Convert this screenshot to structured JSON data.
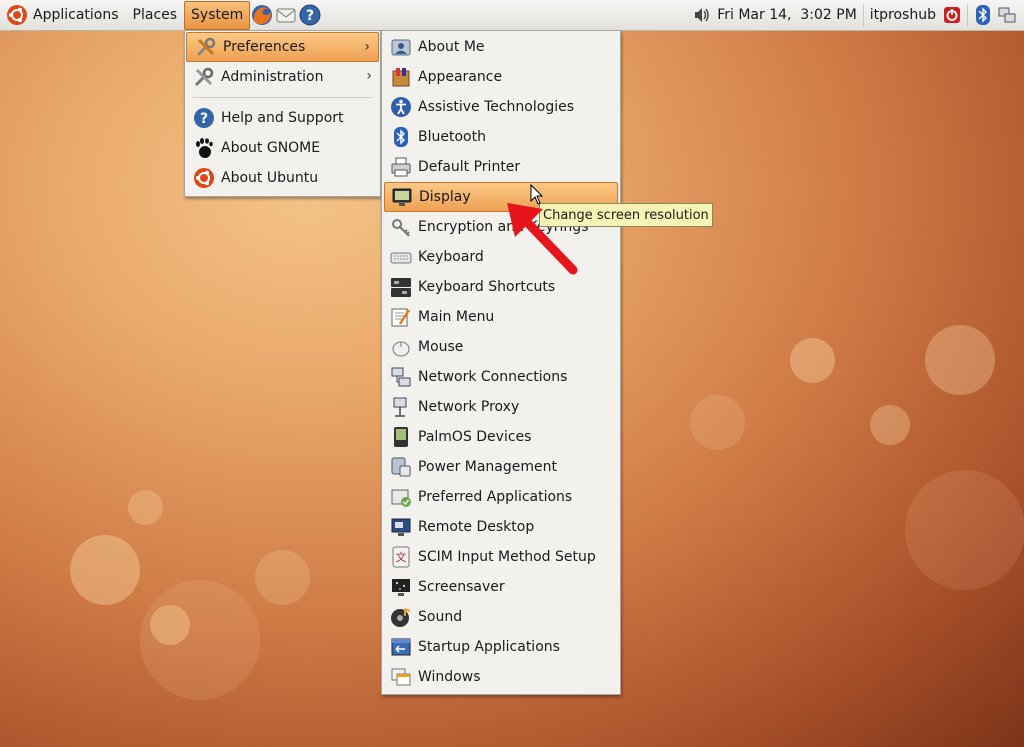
{
  "panel": {
    "applications_label": "Applications",
    "places_label": "Places",
    "system_label": "System",
    "launchers": [
      "firefox-icon",
      "mail-icon",
      "help-icon"
    ],
    "clock": "Fri Mar 14,  3:02 PM",
    "user": "itproshub"
  },
  "system_menu": {
    "items": [
      {
        "label": "Preferences",
        "icon": "preferences-icon",
        "submenu": true
      },
      {
        "label": "Administration",
        "icon": "administration-icon",
        "submenu": true
      },
      {
        "label": "Help and Support",
        "icon": "help-icon"
      },
      {
        "label": "About GNOME",
        "icon": "gnome-foot-icon"
      },
      {
        "label": "About Ubuntu",
        "icon": "ubuntu-logo-icon"
      }
    ]
  },
  "preferences_menu": {
    "items": [
      {
        "label": "About Me",
        "icon": "about-me-icon"
      },
      {
        "label": "Appearance",
        "icon": "appearance-icon"
      },
      {
        "label": "Assistive Technologies",
        "icon": "accessibility-icon"
      },
      {
        "label": "Bluetooth",
        "icon": "bluetooth-icon"
      },
      {
        "label": "Default Printer",
        "icon": "printer-icon"
      },
      {
        "label": "Display",
        "icon": "display-icon"
      },
      {
        "label": "Encryption and Keyrings",
        "icon": "encryption-icon"
      },
      {
        "label": "Keyboard",
        "icon": "keyboard-icon"
      },
      {
        "label": "Keyboard Shortcuts",
        "icon": "keyboard-shortcuts-icon"
      },
      {
        "label": "Main Menu",
        "icon": "main-menu-icon"
      },
      {
        "label": "Mouse",
        "icon": "mouse-icon"
      },
      {
        "label": "Network Connections",
        "icon": "network-connections-icon"
      },
      {
        "label": "Network Proxy",
        "icon": "network-proxy-icon"
      },
      {
        "label": "PalmOS Devices",
        "icon": "palm-device-icon"
      },
      {
        "label": "Power Management",
        "icon": "power-management-icon"
      },
      {
        "label": "Preferred Applications",
        "icon": "preferred-applications-icon"
      },
      {
        "label": "Remote Desktop",
        "icon": "remote-desktop-icon"
      },
      {
        "label": "SCIM Input Method Setup",
        "icon": "scim-icon"
      },
      {
        "label": "Screensaver",
        "icon": "screensaver-icon"
      },
      {
        "label": "Sound",
        "icon": "sound-icon"
      },
      {
        "label": "Startup Applications",
        "icon": "startup-applications-icon"
      },
      {
        "label": "Windows",
        "icon": "windows-icon"
      }
    ]
  },
  "tooltip": "Change screen resolution",
  "colors": {
    "highlight": "#eea052",
    "panel": "#e3e1dc",
    "tooltip_bg": "#f6f4b4",
    "arrow_annotation": "#e8141c"
  }
}
